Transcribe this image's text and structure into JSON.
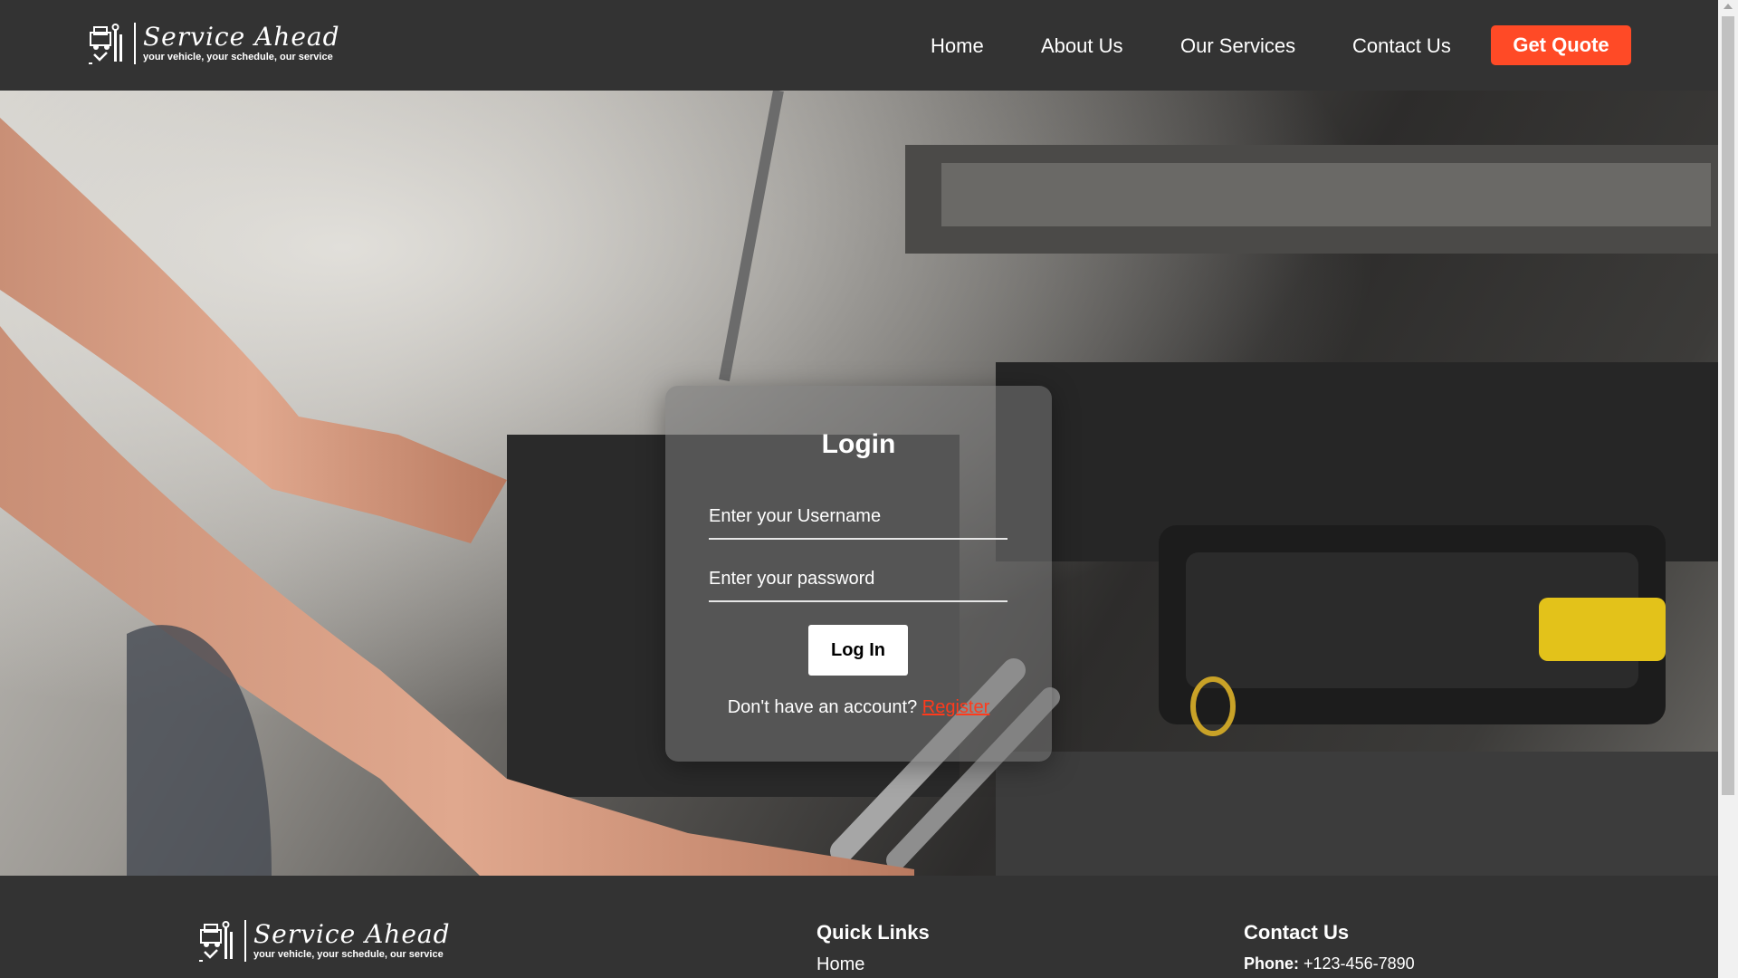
{
  "brand": {
    "name": "Service Ahead",
    "tagline": "your vehicle, your schedule, our service"
  },
  "nav": {
    "items": [
      "Home",
      "About Us",
      "Our Services",
      "Contact Us"
    ],
    "cta": "Get Quote"
  },
  "login": {
    "title": "Login",
    "username_placeholder": "Enter your Username",
    "password_placeholder": "Enter your password",
    "button": "Log In",
    "register_prompt": "Don't have an account?",
    "register_link": "Register"
  },
  "footer": {
    "quick_links_title": "Quick Links",
    "quick_links": [
      "Home"
    ],
    "contact_title": "Contact Us",
    "phone_label": "Phone:",
    "phone": "+123-456-7890"
  },
  "colors": {
    "accent": "#ff4a26",
    "nav_bg": "#333333",
    "register_link": "#ff3a1c"
  },
  "icons": [
    "service-logo-icon",
    "scroll-up-icon"
  ]
}
